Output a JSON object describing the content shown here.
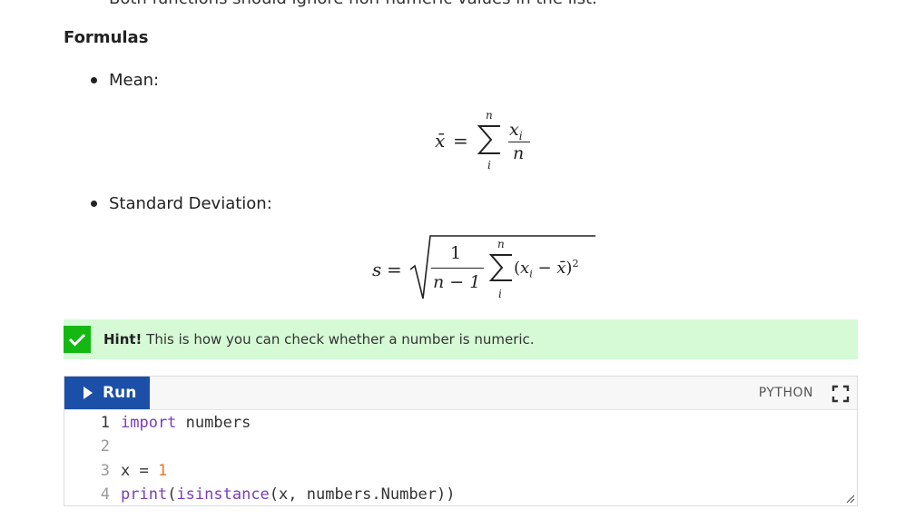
{
  "content": {
    "cut_off_text": "Both functions should ignore non-numeric values in the list.",
    "section_title": "Formulas",
    "bullets": [
      {
        "label": "Mean:"
      },
      {
        "label": "Standard Deviation:"
      }
    ],
    "formulas": {
      "mean": {
        "lhs": "x̄",
        "eq": "=",
        "sum_top": "n",
        "sum_bottom": "i",
        "numerator": "x",
        "numerator_sub": "i",
        "denominator": "n"
      },
      "stddev": {
        "lhs": "s",
        "eq": "=",
        "frac_num": "1",
        "frac_den": "n − 1",
        "sum_top": "n",
        "sum_bottom": "i",
        "term_open": "(",
        "term_x": "x",
        "term_sub": "i",
        "term_minus": " − ",
        "term_mean": "x̄",
        "term_close": ")",
        "exponent": "2"
      }
    }
  },
  "hint": {
    "bold_label": "Hint!",
    "text": " This is how you can check whether a number is numeric.",
    "accent_color": "#13b813",
    "background_color": "#d5fad5"
  },
  "code_editor": {
    "run_label": "Run",
    "language": "PYTHON",
    "run_button_color": "#1b4fa8",
    "lines": [
      {
        "number": "1",
        "tokens": [
          {
            "t": "import",
            "c": "kw"
          },
          {
            "t": " numbers",
            "c": "plain"
          }
        ]
      },
      {
        "number": "2",
        "tokens": []
      },
      {
        "number": "3",
        "tokens": [
          {
            "t": "x = ",
            "c": "plain"
          },
          {
            "t": "1",
            "c": "num"
          }
        ]
      },
      {
        "number": "4",
        "tokens": [
          {
            "t": "print",
            "c": "kw"
          },
          {
            "t": "(",
            "c": "plain"
          },
          {
            "t": "isinstance",
            "c": "kw"
          },
          {
            "t": "(x, numbers.Number))",
            "c": "plain"
          }
        ]
      }
    ],
    "icons": {
      "fullscreen": "fullscreen-icon",
      "run": "play-icon",
      "resize": "resize-grip-icon"
    }
  }
}
